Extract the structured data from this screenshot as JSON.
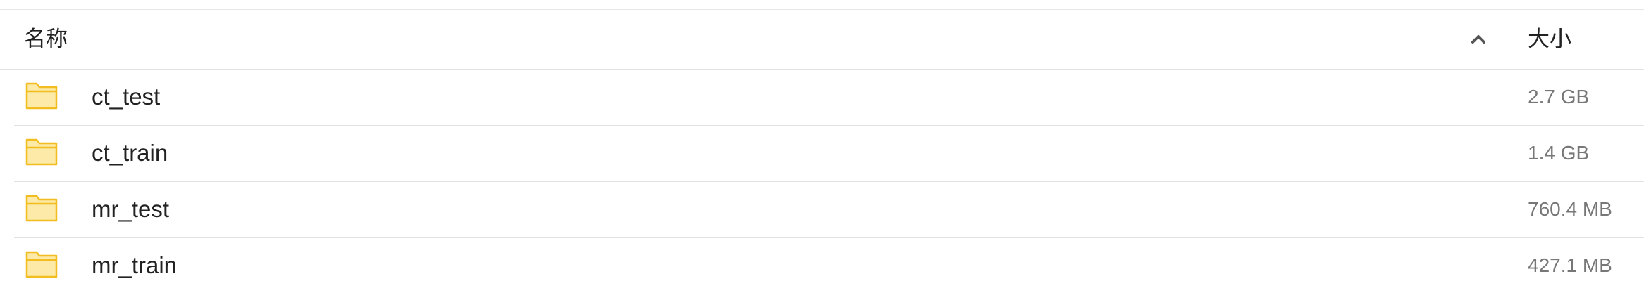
{
  "header": {
    "name_label": "名称",
    "size_label": "大小",
    "sort_icon": "chevron-up-icon"
  },
  "files": [
    {
      "name": "ct_test",
      "size": "2.7 GB",
      "icon": "folder-icon"
    },
    {
      "name": "ct_train",
      "size": "1.4 GB",
      "icon": "folder-icon"
    },
    {
      "name": "mr_test",
      "size": "760.4 MB",
      "icon": "folder-icon"
    },
    {
      "name": "mr_train",
      "size": "427.1 MB",
      "icon": "folder-icon"
    }
  ],
  "colors": {
    "folder_fill": "#fde9a8",
    "folder_stroke": "#f1bd1f",
    "divider": "#e3e3e3",
    "secondary_text": "#777777"
  }
}
